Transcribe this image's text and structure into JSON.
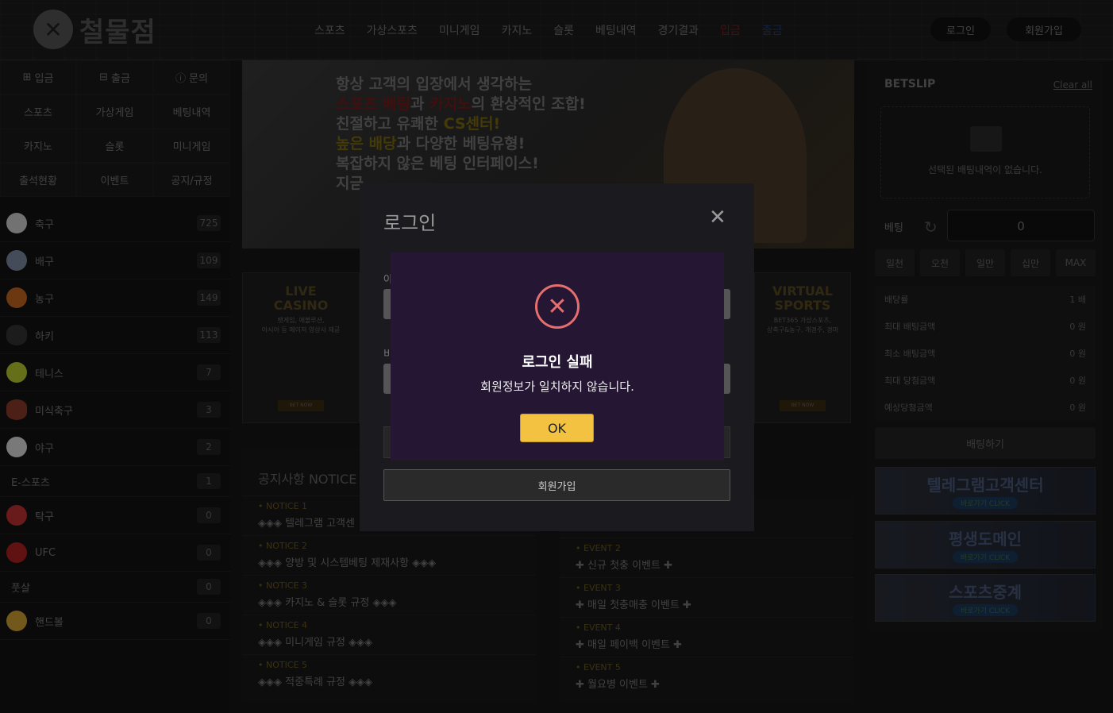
{
  "header": {
    "logo_text": "철물점",
    "nav": [
      {
        "label": "스포츠"
      },
      {
        "label": "가상스포츠"
      },
      {
        "label": "미니게임"
      },
      {
        "label": "카지노"
      },
      {
        "label": "슬롯"
      },
      {
        "label": "베팅내역"
      },
      {
        "label": "경기결과"
      },
      {
        "label": "입금"
      },
      {
        "label": "출금"
      }
    ],
    "login_label": "로그인",
    "signup_label": "회원가입"
  },
  "sidebar": {
    "quick": [
      {
        "label": "입금"
      },
      {
        "label": "출금"
      },
      {
        "label": "문의"
      },
      {
        "label": "스포츠"
      },
      {
        "label": "가상게임"
      },
      {
        "label": "베팅내역"
      },
      {
        "label": "카지노"
      },
      {
        "label": "슬롯"
      },
      {
        "label": "미니게임"
      },
      {
        "label": "출석현황"
      },
      {
        "label": "이벤트"
      },
      {
        "label": "공지/규정"
      }
    ],
    "sports": [
      {
        "label": "축구",
        "count": "725",
        "color": "#cfcfcf"
      },
      {
        "label": "배구",
        "count": "109",
        "color": "#7a8aa0"
      },
      {
        "label": "농구",
        "count": "149",
        "color": "#c4661f"
      },
      {
        "label": "하키",
        "count": "113",
        "color": "#333333"
      },
      {
        "label": "테니스",
        "count": "7",
        "color": "#b8c92e"
      },
      {
        "label": "미식축구",
        "count": "3",
        "color": "#8a3a2a"
      },
      {
        "label": "야구",
        "count": "2",
        "color": "#dddddd"
      },
      {
        "label": "E-스포츠",
        "count": "1",
        "color": ""
      },
      {
        "label": "탁구",
        "count": "0",
        "color": "#c03030"
      },
      {
        "label": "UFC",
        "count": "0",
        "color": "#b02020"
      },
      {
        "label": "풋살",
        "count": "0",
        "color": ""
      },
      {
        "label": "핸드볼",
        "count": "0",
        "color": "#d0a030"
      }
    ]
  },
  "banner": {
    "line1": "항상 고객의 입장에서 생각하는",
    "line2a": "스포츠 베팅",
    "line2b": "과 ",
    "line2c": "카지노",
    "line2d": "의 환상적인 조합!",
    "line3a": "친절하고 유쾌한 ",
    "line3b": "CS센터!",
    "line4a": "높은 배당",
    "line4b": "과 다양한 베팅유형!",
    "line5": "복잡하지 않은 베팅 인터페이스!",
    "line6": "지금"
  },
  "promos": {
    "casino": {
      "title1": "LIVE",
      "title2": "CASINO",
      "sub1": "뱃게임, 에볼루션,",
      "sub2": "아시아 등 메이저 영상사 제공",
      "btn": "BET NOW"
    },
    "virtual": {
      "title1": "VIRTUAL",
      "title2": "SPORTS",
      "sub1": "BET365 가상스포츠,",
      "sub2": "상축구&농구, 개경주, 경마",
      "btn": "BET NOW"
    }
  },
  "notice": {
    "title": "공지사항 NOTICE",
    "items": [
      {
        "key": "NOTICE 1",
        "text": "◈◈◈ 텔레그램 고객센"
      },
      {
        "key": "NOTICE 2",
        "text": "◈◈◈ 양방 및 시스템베팅 제재사항 ◈◈◈"
      },
      {
        "key": "NOTICE 3",
        "text": "◈◈◈ 카지노 & 슬롯 규정 ◈◈◈"
      },
      {
        "key": "NOTICE 4",
        "text": "◈◈◈ 미니게임 규정 ◈◈◈"
      },
      {
        "key": "NOTICE 5",
        "text": "◈◈◈ 적중특례 규정 ◈◈◈"
      }
    ]
  },
  "events": {
    "items": [
      {
        "key": "EVENT 2",
        "text": "✚ 신규 첫충 이벤트 ✚"
      },
      {
        "key": "EVENT 3",
        "text": "✚ 매일 첫충매충 이벤트 ✚"
      },
      {
        "key": "EVENT 4",
        "text": "✚ 매일 페이백 이벤트 ✚"
      },
      {
        "key": "EVENT 5",
        "text": "✚ 월요병 이벤트 ✚"
      }
    ]
  },
  "betslip": {
    "title": "BETSLIP",
    "clear": "Clear all",
    "empty": "선택된 배팅내역이 없습니다.",
    "bet_label": "베팅",
    "amount": "0",
    "chips": [
      "일천",
      "오천",
      "일만",
      "십만",
      "MAX"
    ],
    "info": [
      {
        "label": "배당률",
        "value": "1 배"
      },
      {
        "label": "최대 배팅금액",
        "value": "0 원"
      },
      {
        "label": "최소 배팅금액",
        "value": "0 원"
      },
      {
        "label": "최대 당첨금액",
        "value": "0 원"
      },
      {
        "label": "예상당첨금액",
        "value": "0 원"
      }
    ],
    "submit": "배팅하기"
  },
  "ads": [
    {
      "title": "텔레그램고객센터",
      "cta": "바로가기 CLICK"
    },
    {
      "title": "평생도메인",
      "cta": "바로가기 CLICK"
    },
    {
      "title": "스포츠중계",
      "cta": "바로가기 CLICK"
    }
  ],
  "login_modal": {
    "title": "로그인",
    "close": "✕",
    "id_label": "아",
    "pw_label": "비",
    "signup": "회원가입"
  },
  "alert": {
    "icon": "✕",
    "title": "로그인 실패",
    "message": "회원정보가 일치하지 않습니다.",
    "ok": "OK"
  }
}
